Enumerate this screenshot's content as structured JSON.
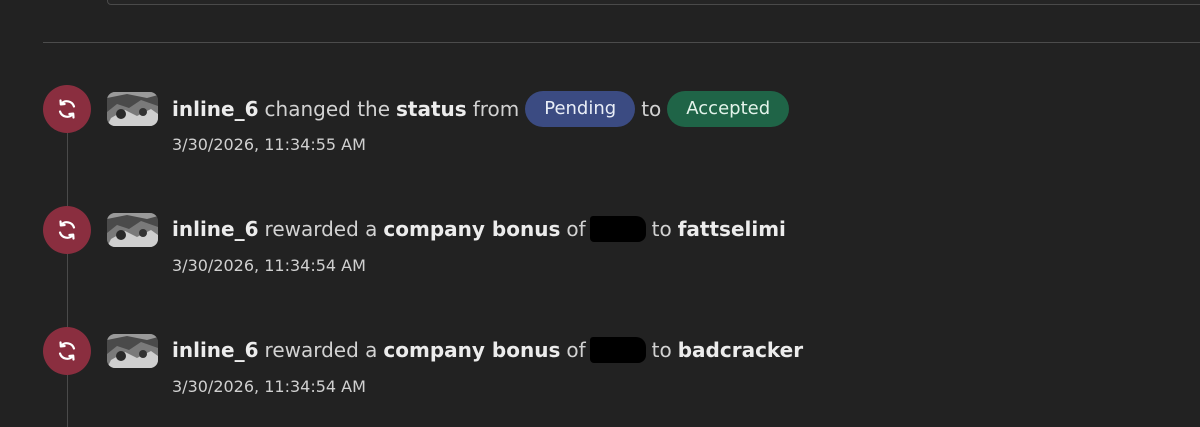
{
  "colors": {
    "background": "#222222",
    "event_icon_bg": "#8a2e3f",
    "pending_pill": "#3b4b82",
    "accepted_pill": "#1f6447"
  },
  "events": [
    {
      "icon": "sync-icon",
      "user": "inline_6",
      "action": "changed the",
      "field": "status",
      "from_word": "from",
      "from_value": "Pending",
      "to_word": "to",
      "to_value": "Accepted",
      "timestamp": "3/30/2026, 11:34:55 AM"
    },
    {
      "icon": "sync-icon",
      "user": "inline_6",
      "action": "rewarded a",
      "field": "company bonus",
      "of_word": "of",
      "to_word": "to",
      "recipient": "fattselimi",
      "timestamp": "3/30/2026, 11:34:54 AM"
    },
    {
      "icon": "sync-icon",
      "user": "inline_6",
      "action": "rewarded a",
      "field": "company bonus",
      "of_word": "of",
      "to_word": "to",
      "recipient": "badcracker",
      "timestamp": "3/30/2026, 11:34:54 AM"
    }
  ]
}
